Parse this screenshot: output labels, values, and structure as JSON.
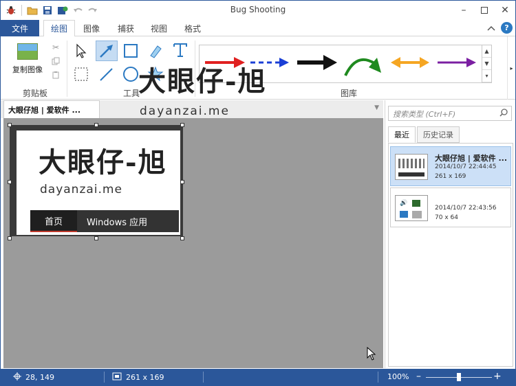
{
  "window": {
    "title": "Bug Shooting"
  },
  "ribbon_tabs": [
    {
      "label": "文件"
    },
    {
      "label": "绘图"
    },
    {
      "label": "图像"
    },
    {
      "label": "捕获"
    },
    {
      "label": "视图"
    },
    {
      "label": "格式"
    }
  ],
  "clipboard": {
    "copy_image_label": "复制图像",
    "group_label": "剪贴板"
  },
  "tools": {
    "group_label": "工具"
  },
  "gallery": {
    "group_label": "图库"
  },
  "document": {
    "tab_title": "大眼仔旭 | 爱软件 ..."
  },
  "preview": {
    "logo_cn": "大眼仔-旭",
    "logo_en": "dayanzai.me",
    "nav_home": "首页",
    "nav_windows": "Windows 应用"
  },
  "watermark": {
    "cn": "大眼仔-旭",
    "en": "dayanzai.me"
  },
  "panel": {
    "search_placeholder": "搜索类型 (Ctrl+F)",
    "tab_recent": "最近",
    "tab_history": "历史记录",
    "items": [
      {
        "name": "大眼仔旭 | 爱软件 ...",
        "date": "2014/10/7 22:44:45",
        "size": "261 x 169"
      },
      {
        "name": "",
        "date": "2014/10/7 22:43:56",
        "size": "70 x 64"
      }
    ]
  },
  "status": {
    "cursor_pos": "28, 149",
    "selection_size": "261 x 169",
    "zoom": "100%",
    "zoom_level_fraction": 0.5
  },
  "colors": {
    "accent": "#2b579a",
    "arrow_red": "#e02020",
    "arrow_blue": "#1a3fd6",
    "arrow_green": "#1f8a1f",
    "arrow_orange": "#f5a623",
    "arrow_purple": "#7b1fa2"
  }
}
